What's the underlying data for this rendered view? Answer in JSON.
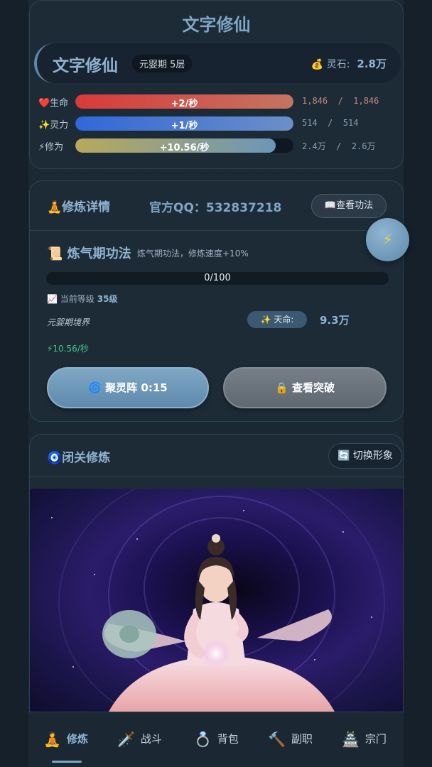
{
  "header": {
    "app_title": "文字修仙",
    "realm_name": "文字修仙",
    "realm_level": "元婴期 5层",
    "stone_label": "💰 灵石:",
    "stone_value": "2.8万"
  },
  "stats": [
    {
      "label": "❤️生命",
      "rate": "+2/秒",
      "nums": "1,846  /  1,846",
      "fill": 1.0
    },
    {
      "label": "✨灵力",
      "rate": "+1/秒",
      "nums": "514  /  514",
      "fill": 1.0
    },
    {
      "label": "⚡修为",
      "rate": "+10.56/秒",
      "nums": "2.4万  /  2.6万",
      "fill": 0.92
    }
  ],
  "detail": {
    "title": "🧘修炼详情",
    "qq": "官方QQ：532837218",
    "view_button": "📖查看功法",
    "method_title": "📜 炼气期功法",
    "method_desc": "炼气期功法，修炼速度+10%",
    "progress_text": "0/100",
    "progress": 0.0,
    "level_label": "📈 当前等级",
    "level_value": "35级",
    "realm_line": "元婴期境界",
    "fate_label": "✨ 天命:",
    "fate_value": "9.3万",
    "speed": "⚡10.56/秒",
    "gather_button": "🌀 聚灵阵 0:15",
    "break_button": "🔒 查看突破",
    "float_icon": "⚡"
  },
  "retreat": {
    "title": "🧿闭关修炼",
    "switch_button": "🔄 切换形象"
  },
  "nav": [
    {
      "icon": "🧘",
      "label": "修炼"
    },
    {
      "icon": "🗡️",
      "label": "战斗"
    },
    {
      "icon": "💍",
      "label": "背包"
    },
    {
      "icon": "🔨",
      "label": "副职"
    },
    {
      "icon": "🏯",
      "label": "宗门"
    }
  ]
}
